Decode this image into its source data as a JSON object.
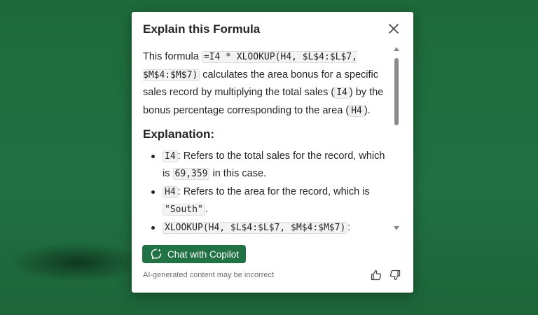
{
  "dialog": {
    "title": "Explain this Formula",
    "close_icon": "close-icon"
  },
  "content": {
    "intro_text_1": "This formula ",
    "formula_code": "=I4 * XLOOKUP(H4, $L$4:$L$7, $M$4:$M$7)",
    "intro_text_2": " calculates the area bonus for a specific sales record by multiplying the total sales (",
    "total_sales_ref": "I4",
    "intro_text_3": ") by the bonus percentage corresponding to the area (",
    "area_ref": "H4",
    "intro_text_4": ").",
    "section_title": "Explanation:",
    "bullets": [
      {
        "code": "I4",
        "text_1": ": Refers to the total sales for the record, which is ",
        "value_code": "69,359",
        "text_2": " in this case."
      },
      {
        "code": "H4",
        "text_1": ": Refers to the area for the record, which is ",
        "value_code": "\"South\"",
        "text_2": "."
      },
      {
        "code": "XLOOKUP(H4, $L$4:$L$7, $M$4:$M$7)",
        "text_1": ":"
      }
    ]
  },
  "footer": {
    "copilot_button_label": "Chat with Copilot",
    "copilot_icon": "copilot-chat-icon",
    "disclaimer": "AI-generated content may be incorrect",
    "thumbs_up_icon": "thumbs-up-icon",
    "thumbs_down_icon": "thumbs-down-icon"
  },
  "colors": {
    "background": "#1f6b3c",
    "accent": "#217346"
  }
}
